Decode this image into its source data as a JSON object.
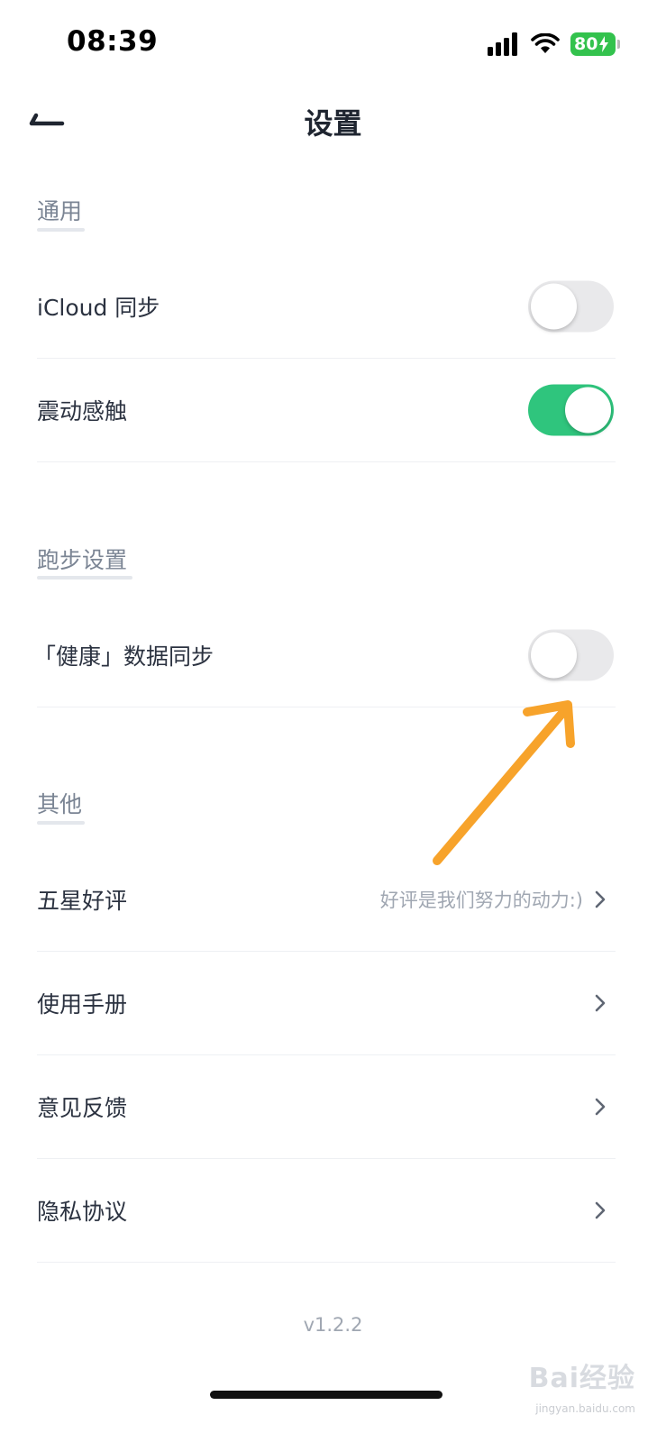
{
  "status_bar": {
    "time": "08:39",
    "battery": "80"
  },
  "nav": {
    "title": "设置"
  },
  "sections": {
    "general": {
      "header": "通用",
      "icloud_label": "iCloud 同步",
      "icloud_on": false,
      "vibration_label": "震动感触",
      "vibration_on": true
    },
    "running": {
      "header": "跑步设置",
      "health_label": "「健康」数据同步",
      "health_on": false
    },
    "other": {
      "header": "其他",
      "rate_label": "五星好评",
      "rate_hint": "好评是我们努力的动力:)",
      "manual_label": "使用手册",
      "feedback_label": "意见反馈",
      "privacy_label": "隐私协议"
    }
  },
  "footer": {
    "version": "v1.2.2"
  },
  "watermark": {
    "logo": "Bai经验",
    "site": "jingyan.baidu.com"
  },
  "colors": {
    "toggle_on": "#2fc57d",
    "toggle_off": "#e9e9eb",
    "annotation_arrow": "#f7a32b",
    "battery": "#33c24d"
  }
}
